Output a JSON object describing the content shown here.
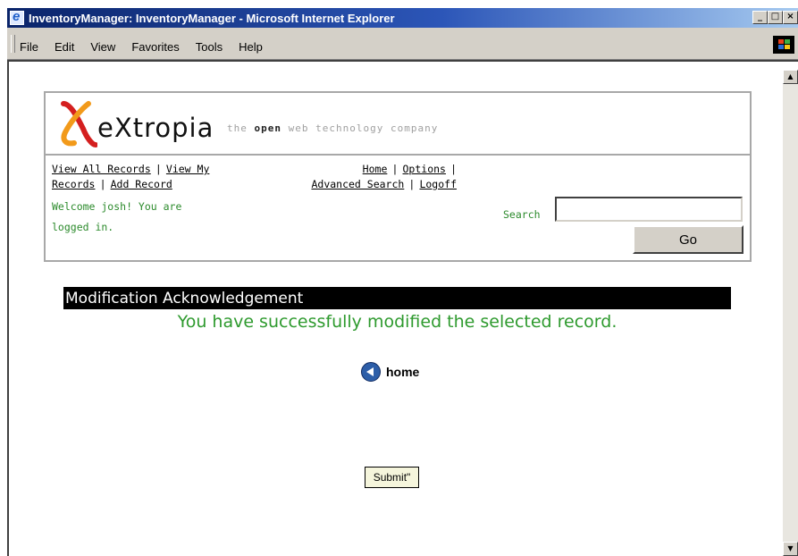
{
  "window": {
    "title": "InventoryManager: InventoryManager - Microsoft Internet Explorer",
    "buttons": [
      "_",
      "□",
      "×"
    ]
  },
  "menubar": {
    "items": [
      "File",
      "Edit",
      "View",
      "Favorites",
      "Tools",
      "Help"
    ]
  },
  "header": {
    "logo_text": "eXtropia",
    "tagline_pre": "the ",
    "tagline_bold": "open",
    "tagline_post": " web technology company",
    "nav_left": {
      "view_all": "View All Records",
      "view_my_1": "View My",
      "view_my_2": "Records",
      "add_record": "Add Record",
      "sep": "|"
    },
    "nav_center": {
      "home": "Home",
      "options": "Options",
      "advanced_search": "Advanced Search",
      "logoff": "Logoff",
      "sep": "|"
    },
    "welcome_line1": "Welcome josh! You are",
    "welcome_line2": "logged in.",
    "search_label": "Search",
    "search_value": "",
    "go_label": "Go"
  },
  "content": {
    "ack_title": "Modification Acknowledgement",
    "ack_message": "You have successfully modified the selected record.",
    "home_label": "home",
    "submit_label": "Submit\""
  },
  "colors": {
    "title_bar_start": "#0a246a",
    "title_bar_end": "#a6caf0",
    "chrome": "#d4d0c8",
    "green_text": "#2e9a2e",
    "ack_bar": "#000000",
    "logo_orange": "#f29a1a",
    "logo_red": "#d41f1f"
  },
  "icons": {
    "title_icon": "ie-icon",
    "menubar_logo": "windows-logo-icon",
    "home_icon": "back-arrow-circle-icon"
  }
}
